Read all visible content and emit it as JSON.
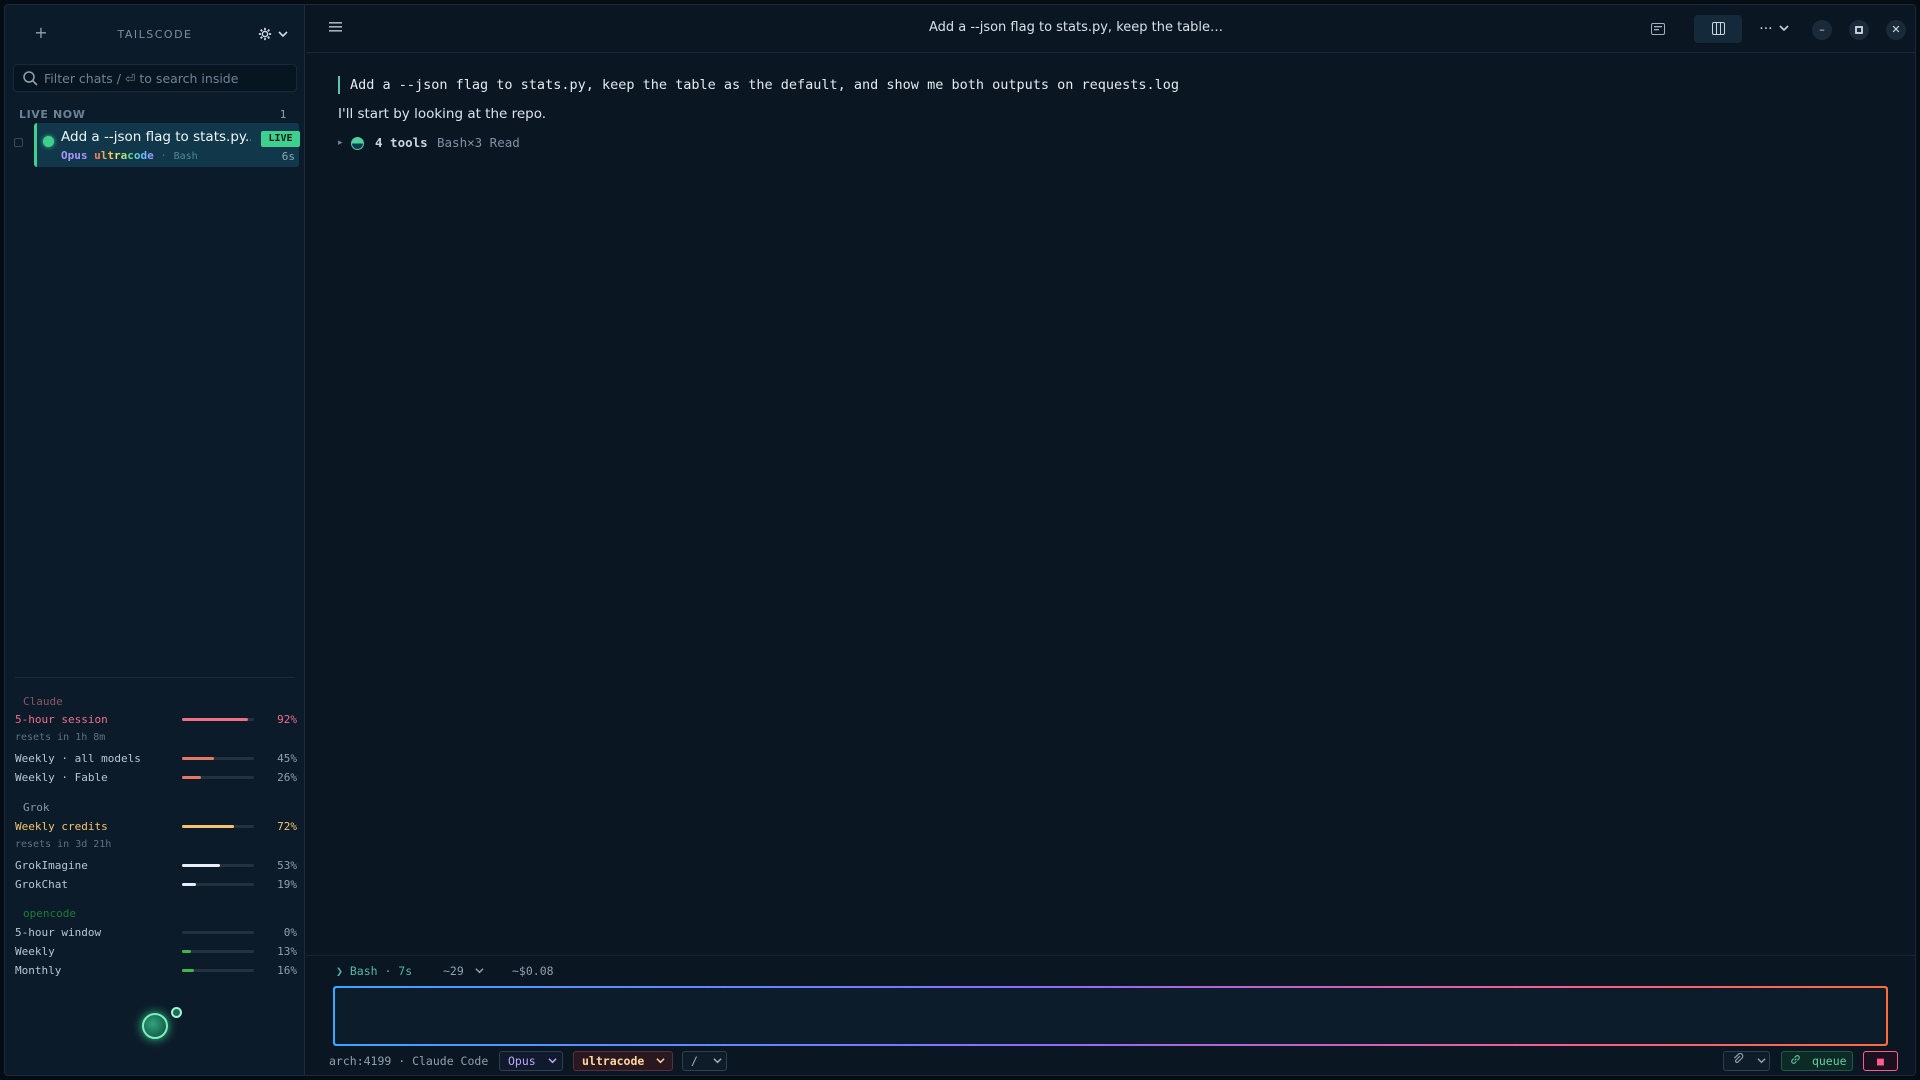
{
  "sidebar": {
    "brand": "TAILSCODE",
    "plus_icon": "plus-icon",
    "search": {
      "placeholder": "Filter chats  /   ⏎ to search inside"
    },
    "live_section": {
      "title": "LIVE NOW",
      "count": "1"
    },
    "chats": [
      {
        "title": "Add a --json flag to stats.py...",
        "badge": "LIVE",
        "model": "Opus",
        "mode": "ultracode",
        "tool": "Bash",
        "age": "6s"
      }
    ]
  },
  "usage": {
    "claude": {
      "label": "Claude",
      "rows": [
        {
          "label": "5-hour session",
          "pct": "92%",
          "value": 0.92,
          "sub": "resets in 1h 8m"
        },
        {
          "label": "Weekly · all models",
          "pct": "45%",
          "value": 0.45
        },
        {
          "label": "Weekly · Fable",
          "pct": "26%",
          "value": 0.26
        }
      ]
    },
    "grok": {
      "label": "Grok",
      "rows": [
        {
          "label": "Weekly credits",
          "pct": "72%",
          "value": 0.72,
          "sub": "resets in 3d 21h"
        },
        {
          "label": "GrokImagine",
          "pct": "53%",
          "value": 0.53
        },
        {
          "label": "GrokChat",
          "pct": "19%",
          "value": 0.19
        }
      ]
    },
    "opencode": {
      "label": "opencode",
      "rows": [
        {
          "label": "5-hour window",
          "pct": "0%",
          "value": 0.0
        },
        {
          "label": "Weekly",
          "pct": "13%",
          "value": 0.13
        },
        {
          "label": "Monthly",
          "pct": "16%",
          "value": 0.16
        }
      ]
    },
    "colors": {
      "claude_hot": "#f26d8a",
      "claude_warm": "#e87a63",
      "grok_hot": "#f5c46b",
      "grok_norm": "#e8eef5",
      "opencode": "#3bb84a"
    }
  },
  "header": {
    "title": "Add a --json flag to stats.py, keep the table…",
    "more_label": "···"
  },
  "messages": {
    "user": "Add a --json flag to stats.py, keep the table as the default, and show me both outputs on requests.log",
    "assistant": "I'll start by looking at the repo.",
    "tools": {
      "count_label": "4 tools",
      "detail": "Bash×3 Read"
    }
  },
  "composer": {
    "status": {
      "running": "❯ Bash · 7s",
      "context": "~29",
      "cost": "~$0.08"
    },
    "info": "arch:4199 · Claude Code",
    "model": "Opus",
    "mode": "ultracode",
    "slash": "/",
    "queue_label": "queue",
    "stop_label": "■"
  }
}
